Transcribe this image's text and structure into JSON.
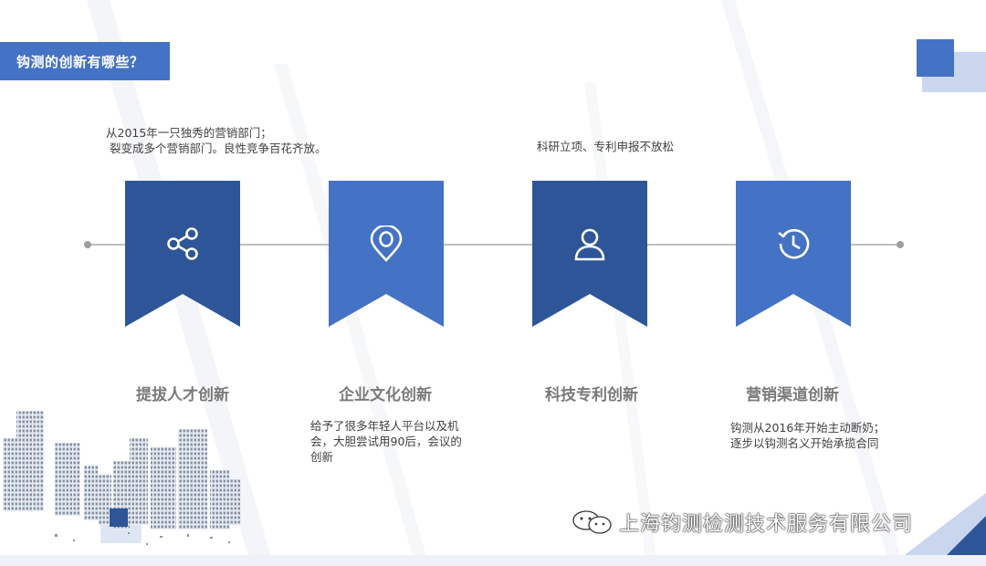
{
  "header": {
    "title": "钩测的创新有哪些？"
  },
  "notes": {
    "top_left_line1": "从2015年一只独秀的营销部门；",
    "top_left_line2": "裂变成多个营销部门。良性竞争百花齐放。",
    "top_center": "科研立项、专利申报不放松",
    "bottom_second": "给予了很多年轻人平台以及机会，大胆尝试用90后，会议的创新",
    "bottom_fourth_line1": "钩测从2016年开始主动断奶；",
    "bottom_fourth_line2": "逐步以钩测名义开始承揽合同"
  },
  "items": [
    {
      "heading": "提拔人才创新",
      "icon": "share-icon",
      "color": "#2E5597"
    },
    {
      "heading": "企业文化创新",
      "icon": "location-pin-icon",
      "color": "#4472C4"
    },
    {
      "heading": "科技专利创新",
      "icon": "user-icon",
      "color": "#2E5597"
    },
    {
      "heading": "营销渠道创新",
      "icon": "history-clock-icon",
      "color": "#4472C4"
    }
  ],
  "watermark": {
    "text": "上海钧测检测技术服务有限公司",
    "icon": "wechat-icon"
  },
  "colors": {
    "accent": "#4472C4",
    "dark": "#2E5597",
    "light": "#C9D6EE"
  }
}
